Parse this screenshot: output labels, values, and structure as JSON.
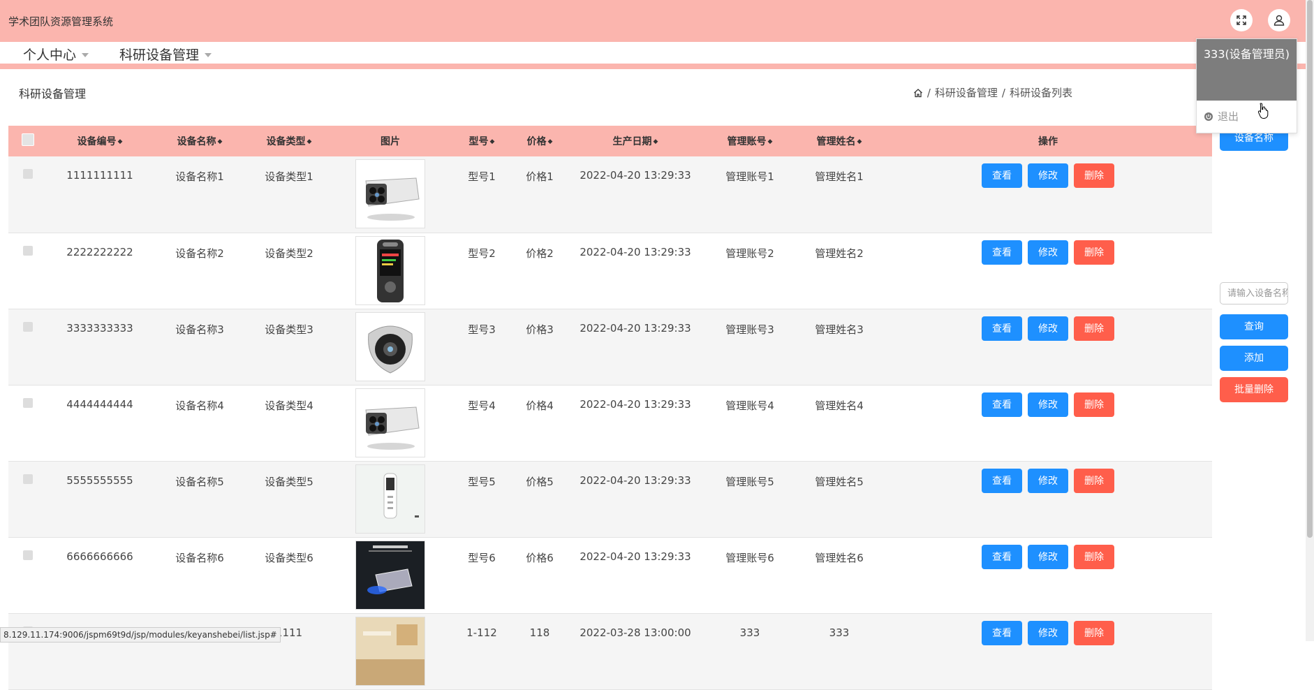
{
  "app": {
    "title": "学术团队资源管理系统"
  },
  "header": {
    "fullscreen_icon": "expand-icon",
    "user_icon": "user-icon"
  },
  "nav": [
    {
      "label": "个人中心"
    },
    {
      "label": "科研设备管理"
    }
  ],
  "page": {
    "title": "科研设备管理"
  },
  "breadcrumb": {
    "home_icon": "home-icon",
    "level1": "科研设备管理",
    "sep": "/",
    "level2": "科研设备列表"
  },
  "table": {
    "columns": [
      "设备编号",
      "设备名称",
      "设备类型",
      "图片",
      "型号",
      "价格",
      "生产日期",
      "管理账号",
      "管理姓名",
      "操作"
    ],
    "rows": [
      {
        "code": "1111111111",
        "name": "设备名称1",
        "type": "设备类型1",
        "image": "camera-bullet",
        "model": "型号1",
        "price": "价格1",
        "date": "2022-04-20 13:29:33",
        "account": "管理账号1",
        "manager": "管理姓名1"
      },
      {
        "code": "2222222222",
        "name": "设备名称2",
        "type": "设备类型2",
        "image": "voice-recorder",
        "model": "型号2",
        "price": "价格2",
        "date": "2022-04-20 13:29:33",
        "account": "管理账号2",
        "manager": "管理姓名2"
      },
      {
        "code": "3333333333",
        "name": "设备名称3",
        "type": "设备类型3",
        "image": "dome-camera",
        "model": "型号3",
        "price": "价格3",
        "date": "2022-04-20 13:29:33",
        "account": "管理账号3",
        "manager": "管理姓名3"
      },
      {
        "code": "4444444444",
        "name": "设备名称4",
        "type": "设备类型4",
        "image": "camera-bullet",
        "model": "型号4",
        "price": "价格4",
        "date": "2022-04-20 13:29:33",
        "account": "管理账号4",
        "manager": "管理姓名4"
      },
      {
        "code": "5555555555",
        "name": "设备名称5",
        "type": "设备类型5",
        "image": "pen-recorder",
        "model": "型号5",
        "price": "价格5",
        "date": "2022-04-20 13:29:33",
        "account": "管理账号5",
        "manager": "管理姓名5"
      },
      {
        "code": "6666666666",
        "name": "设备名称6",
        "type": "设备类型6",
        "image": "dark-recorder",
        "model": "型号6",
        "price": "价格6",
        "date": "2022-04-20 13:29:33",
        "account": "管理账号6",
        "manager": "管理姓名6"
      },
      {
        "code": "",
        "name": "",
        "type": "1111",
        "image": "room-photo",
        "model": "1-112",
        "price": "118",
        "date": "2022-03-28 13:00:00",
        "account": "333",
        "manager": "333"
      }
    ],
    "actions": {
      "view": "查看",
      "edit": "修改",
      "delete": "删除"
    }
  },
  "side": {
    "search_label": "设备名称",
    "search_placeholder": "请输入设备名称",
    "query": "查询",
    "add": "添加",
    "batch_delete": "批量删除"
  },
  "dropdown": {
    "user": "333(设备管理员)",
    "logout": "退出"
  },
  "statusbar": {
    "url": "8.129.11.174:9006/jspm69t9d/jsp/modules/keyanshebei/list.jsp#"
  },
  "colors": {
    "header_bg": "#fbb5ae",
    "primary": "#1e90ff",
    "danger": "#ff5e4b"
  }
}
